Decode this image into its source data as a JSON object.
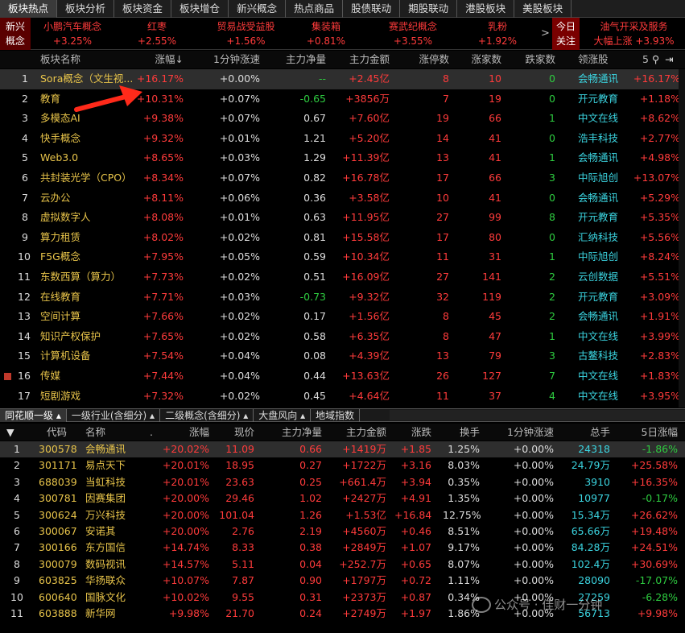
{
  "top_tabs": [
    "板块热点",
    "板块分析",
    "板块资金",
    "板块增仓",
    "新兴概念",
    "热点商品",
    "股债联动",
    "期股联动",
    "港股板块",
    "美股板块"
  ],
  "hot_strip": {
    "left_label": [
      "新兴",
      "概念"
    ],
    "items": [
      {
        "name": "小鹏汽车概念",
        "pct": "+3.25%"
      },
      {
        "name": "红枣",
        "pct": "+2.55%"
      },
      {
        "name": "贸易战受益股",
        "pct": "+1.56%"
      },
      {
        "name": "集装箱",
        "pct": "+0.81%"
      },
      {
        "name": "赛武纪概念",
        "pct": "+3.55%"
      },
      {
        "name": "乳粉",
        "pct": "+1.92%"
      }
    ],
    "arrow": ">",
    "today_label": [
      "今日",
      "关注"
    ],
    "last_name": "油气开采及服务",
    "last_sub": "大幅上涨 +3.93%"
  },
  "upper_headers": [
    "板块名称",
    "涨幅↓",
    "1分钟涨速",
    "主力净量",
    "主力金额",
    "涨停数",
    "涨家数",
    "跌家数",
    "领涨股",
    "5"
  ],
  "upper_rows": [
    {
      "n": "1",
      "name": "Sora概念（文生视...",
      "pct": "+16.17%",
      "spd": "+0.00%",
      "net": "--",
      "amt": "+2.45亿",
      "zt": "8",
      "up": "10",
      "dn": "0",
      "lead": "会畅通讯",
      "lpct": "+16.17%"
    },
    {
      "n": "2",
      "name": "教育",
      "pct": "+10.31%",
      "spd": "+0.07%",
      "net": "-0.65",
      "amt": "+3856万",
      "zt": "7",
      "up": "19",
      "dn": "0",
      "lead": "开元教育",
      "lpct": "+1.18%"
    },
    {
      "n": "3",
      "name": "多模态AI",
      "pct": "+9.38%",
      "spd": "+0.07%",
      "net": "0.67",
      "amt": "+7.60亿",
      "zt": "19",
      "up": "66",
      "dn": "1",
      "lead": "中文在线",
      "lpct": "+8.62%"
    },
    {
      "n": "4",
      "name": "快手概念",
      "pct": "+9.32%",
      "spd": "+0.01%",
      "net": "1.21",
      "amt": "+5.20亿",
      "zt": "14",
      "up": "41",
      "dn": "0",
      "lead": "浩丰科技",
      "lpct": "+2.77%"
    },
    {
      "n": "5",
      "name": "Web3.0",
      "pct": "+8.65%",
      "spd": "+0.03%",
      "net": "1.29",
      "amt": "+11.39亿",
      "zt": "13",
      "up": "41",
      "dn": "1",
      "lead": "会畅通讯",
      "lpct": "+4.98%"
    },
    {
      "n": "6",
      "name": "共封装光学（CPO）",
      "pct": "+8.34%",
      "spd": "+0.07%",
      "net": "0.82",
      "amt": "+16.78亿",
      "zt": "17",
      "up": "66",
      "dn": "3",
      "lead": "中际旭创",
      "lpct": "+13.07%"
    },
    {
      "n": "7",
      "name": "云办公",
      "pct": "+8.11%",
      "spd": "+0.06%",
      "net": "0.36",
      "amt": "+3.58亿",
      "zt": "10",
      "up": "41",
      "dn": "0",
      "lead": "会畅通讯",
      "lpct": "+5.29%"
    },
    {
      "n": "8",
      "name": "虚拟数字人",
      "pct": "+8.08%",
      "spd": "+0.01%",
      "net": "0.63",
      "amt": "+11.95亿",
      "zt": "27",
      "up": "99",
      "dn": "8",
      "lead": "开元教育",
      "lpct": "+5.35%"
    },
    {
      "n": "9",
      "name": "算力租赁",
      "pct": "+8.02%",
      "spd": "+0.02%",
      "net": "0.81",
      "amt": "+15.58亿",
      "zt": "17",
      "up": "80",
      "dn": "0",
      "lead": "汇纳科技",
      "lpct": "+5.56%"
    },
    {
      "n": "10",
      "name": "F5G概念",
      "pct": "+7.95%",
      "spd": "+0.05%",
      "net": "0.59",
      "amt": "+10.34亿",
      "zt": "11",
      "up": "31",
      "dn": "1",
      "lead": "中际旭创",
      "lpct": "+8.24%"
    },
    {
      "n": "11",
      "name": "东数西算（算力）",
      "pct": "+7.73%",
      "spd": "+0.02%",
      "net": "0.51",
      "amt": "+16.09亿",
      "zt": "27",
      "up": "141",
      "dn": "2",
      "lead": "云创数据",
      "lpct": "+5.51%"
    },
    {
      "n": "12",
      "name": "在线教育",
      "pct": "+7.71%",
      "spd": "+0.03%",
      "net": "-0.73",
      "amt": "+9.32亿",
      "zt": "32",
      "up": "119",
      "dn": "2",
      "lead": "开元教育",
      "lpct": "+3.09%"
    },
    {
      "n": "13",
      "name": "空间计算",
      "pct": "+7.66%",
      "spd": "+0.02%",
      "net": "0.17",
      "amt": "+1.56亿",
      "zt": "8",
      "up": "45",
      "dn": "2",
      "lead": "会畅通讯",
      "lpct": "+1.91%"
    },
    {
      "n": "14",
      "name": "知识产权保护",
      "pct": "+7.65%",
      "spd": "+0.02%",
      "net": "0.58",
      "amt": "+6.35亿",
      "zt": "8",
      "up": "47",
      "dn": "1",
      "lead": "中文在线",
      "lpct": "+3.99%"
    },
    {
      "n": "15",
      "name": "计算机设备",
      "pct": "+7.54%",
      "spd": "+0.04%",
      "net": "0.08",
      "amt": "+4.39亿",
      "zt": "13",
      "up": "79",
      "dn": "3",
      "lead": "古鳌科技",
      "lpct": "+2.83%"
    },
    {
      "n": "16",
      "name": "传媒",
      "pct": "+7.44%",
      "spd": "+0.04%",
      "net": "0.44",
      "amt": "+13.63亿",
      "zt": "26",
      "up": "127",
      "dn": "7",
      "lead": "中文在线",
      "lpct": "+1.83%"
    },
    {
      "n": "17",
      "name": "短剧游戏",
      "pct": "+7.32%",
      "spd": "+0.02%",
      "net": "0.45",
      "amt": "+4.64亿",
      "zt": "11",
      "up": "37",
      "dn": "4",
      "lead": "中文在线",
      "lpct": "+3.95%"
    }
  ],
  "bottom_tabs": [
    "同花顺一级",
    "一级行业(含细分)",
    "二级概念(含细分)",
    "大盘风向",
    "地域指数"
  ],
  "lower_headers": [
    "代码",
    "名称",
    ".",
    "涨幅",
    "现价",
    "主力净量",
    "主力金额",
    "涨跌",
    "换手",
    "1分钟涨速",
    "总手",
    "5日涨幅"
  ],
  "lower_rows": [
    {
      "n": "1",
      "code": "300578",
      "name": "会畅通讯",
      "pct": "+20.02%",
      "price": "11.09",
      "net": "0.66",
      "amt": "+1419万",
      "chg": "+1.85",
      "turn": "1.25%",
      "spd": "+0.00%",
      "vol": "24318",
      "p5": "-1.86%"
    },
    {
      "n": "2",
      "code": "301171",
      "name": "易点天下",
      "pct": "+20.01%",
      "price": "18.95",
      "net": "0.27",
      "amt": "+1722万",
      "chg": "+3.16",
      "turn": "8.03%",
      "spd": "+0.00%",
      "vol": "24.79万",
      "p5": "+25.58%"
    },
    {
      "n": "3",
      "code": "688039",
      "name": "当虹科技",
      "pct": "+20.01%",
      "price": "23.63",
      "net": "0.25",
      "amt": "+661.4万",
      "chg": "+3.94",
      "turn": "0.35%",
      "spd": "+0.00%",
      "vol": "3910",
      "p5": "+16.35%"
    },
    {
      "n": "4",
      "code": "300781",
      "name": "因赛集团",
      "pct": "+20.00%",
      "price": "29.46",
      "net": "1.02",
      "amt": "+2427万",
      "chg": "+4.91",
      "turn": "1.35%",
      "spd": "+0.00%",
      "vol": "10977",
      "p5": "-0.17%"
    },
    {
      "n": "5",
      "code": "300624",
      "name": "万兴科技",
      "pct": "+20.00%",
      "price": "101.04",
      "net": "1.26",
      "amt": "+1.53亿",
      "chg": "+16.84",
      "turn": "12.75%",
      "spd": "+0.00%",
      "vol": "15.34万",
      "p5": "+26.62%"
    },
    {
      "n": "6",
      "code": "300067",
      "name": "安诺其",
      "pct": "+20.00%",
      "price": "2.76",
      "net": "2.19",
      "amt": "+4560万",
      "chg": "+0.46",
      "turn": "8.51%",
      "spd": "+0.00%",
      "vol": "65.66万",
      "p5": "+19.48%"
    },
    {
      "n": "7",
      "code": "300166",
      "name": "东方国信",
      "pct": "+14.74%",
      "price": "8.33",
      "net": "0.38",
      "amt": "+2849万",
      "chg": "+1.07",
      "turn": "9.17%",
      "spd": "+0.00%",
      "vol": "84.28万",
      "p5": "+24.51%"
    },
    {
      "n": "8",
      "code": "300079",
      "name": "数码视讯",
      "pct": "+14.57%",
      "price": "5.11",
      "net": "0.04",
      "amt": "+252.7万",
      "chg": "+0.65",
      "turn": "8.07%",
      "spd": "+0.00%",
      "vol": "102.4万",
      "p5": "+30.69%"
    },
    {
      "n": "9",
      "code": "603825",
      "name": "华扬联众",
      "pct": "+10.07%",
      "price": "7.87",
      "net": "0.90",
      "amt": "+1797万",
      "chg": "+0.72",
      "turn": "1.11%",
      "spd": "+0.00%",
      "vol": "28090",
      "p5": "-17.07%"
    },
    {
      "n": "10",
      "code": "600640",
      "name": "国脉文化",
      "pct": "+10.02%",
      "price": "9.55",
      "net": "0.31",
      "amt": "+2373万",
      "chg": "+0.87",
      "turn": "0.34%",
      "spd": "+0.00%",
      "vol": "27259",
      "p5": "-6.28%"
    },
    {
      "n": "11",
      "code": "603888",
      "name": "新华网",
      "pct": "+9.98%",
      "price": "21.70",
      "net": "0.24",
      "amt": "+2749万",
      "chg": "+1.97",
      "turn": "1.86%",
      "spd": "+0.00%",
      "vol": "56713",
      "p5": "+9.98%"
    }
  ],
  "watermark": "公众号 · 佳财一分钟",
  "colors": {
    "up": "#ff3b3b",
    "down": "#2ecc40",
    "name": "#e8c44a",
    "lead": "#3bd4e0",
    "arrow": "#ff2a1a"
  }
}
